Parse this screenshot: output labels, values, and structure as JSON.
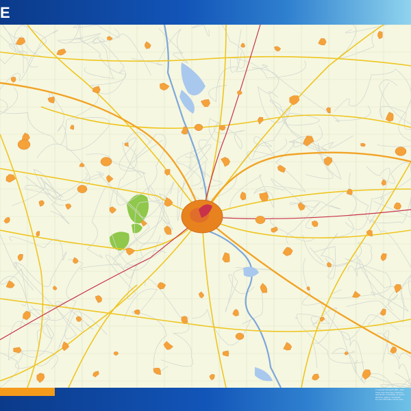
{
  "header": {
    "title": "E",
    "colors": {
      "start": "#0b3a8a",
      "end": "#8fd4ee"
    }
  },
  "map": {
    "colors": {
      "background": "#f5f7e1",
      "grid": "#dfe6c4",
      "minor_road": "#d4d9d0",
      "major_road": "#efc51f",
      "motorway": "#f2a325",
      "rail": "#c8324a",
      "river": "#7ea6d9",
      "water": "#a9c8ee",
      "town": "#f5a23a",
      "city_center": "#e8821e",
      "forest": "#8fc84a"
    }
  },
  "footer": {
    "copyright_lines": [
      "© Copyright Netmaps® 1997 - 2016",
      "These maps have been created by...",
      "reproduction is prohibited, as well as...",
      "electronic, digital or mechanical...",
      "For more information consult: www..."
    ],
    "colors": {
      "badge": "#f59b1c"
    }
  }
}
